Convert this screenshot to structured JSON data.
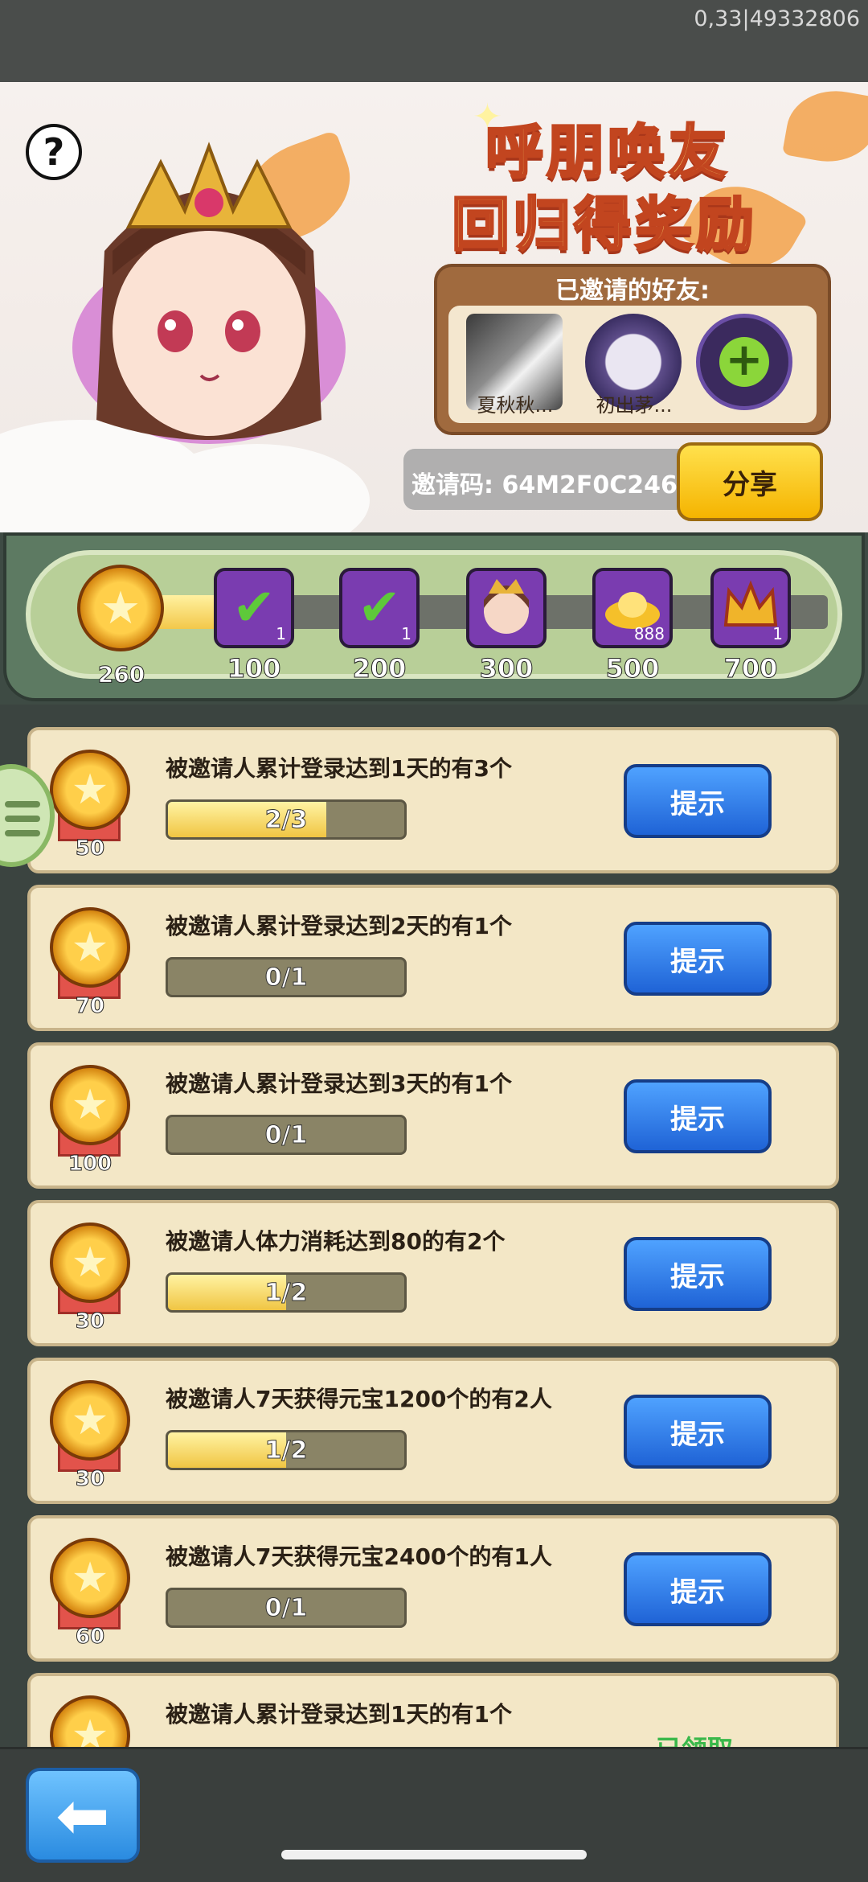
{
  "status": {
    "debug_text": "0,33|49332806"
  },
  "hero": {
    "title_line1": "呼朋唤友",
    "title_line2": "回归得奖励",
    "invited_title": "已邀请的好友:",
    "friends": [
      {
        "name": "夏秋秋...",
        "icon": "cat-avatar"
      },
      {
        "name": "初出茅...",
        "icon": "rabbit-avatar"
      }
    ],
    "add_friend_icon": "plus-icon",
    "invite_code": "邀请码: 64M2F0C246",
    "share_label": "分享"
  },
  "progress": {
    "current_points": "260",
    "milestones": [
      {
        "label": "100",
        "qty": "1",
        "icon": "chest-claimed-icon"
      },
      {
        "label": "200",
        "qty": "1",
        "icon": "chest-claimed-icon"
      },
      {
        "label": "300",
        "qty": "",
        "icon": "hero-portrait-icon"
      },
      {
        "label": "500",
        "qty": "888",
        "icon": "gold-ingot-icon"
      },
      {
        "label": "700",
        "qty": "1",
        "icon": "crown-icon"
      }
    ]
  },
  "tasks": [
    {
      "text": "被邀请人累计登录达到1天的有3个",
      "progress": "2/3",
      "fraction": 0.667,
      "reward": "50",
      "button": "提示"
    },
    {
      "text": "被邀请人累计登录达到2天的有1个",
      "progress": "0/1",
      "fraction": 0,
      "reward": "70",
      "button": "提示"
    },
    {
      "text": "被邀请人累计登录达到3天的有1个",
      "progress": "0/1",
      "fraction": 0,
      "reward": "100",
      "button": "提示"
    },
    {
      "text": "被邀请人体力消耗达到80的有2个",
      "progress": "1/2",
      "fraction": 0.5,
      "reward": "30",
      "button": "提示"
    },
    {
      "text": "被邀请人7天获得元宝1200个的有2人",
      "progress": "1/2",
      "fraction": 0.5,
      "reward": "30",
      "button": "提示"
    },
    {
      "text": "被邀请人7天获得元宝2400个的有1人",
      "progress": "0/1",
      "fraction": 0,
      "reward": "60",
      "button": "提示"
    },
    {
      "text": "被邀请人累计登录达到1天的有1个",
      "status": "已领取"
    }
  ],
  "nav": {
    "back_icon": "back-arrow-icon"
  }
}
